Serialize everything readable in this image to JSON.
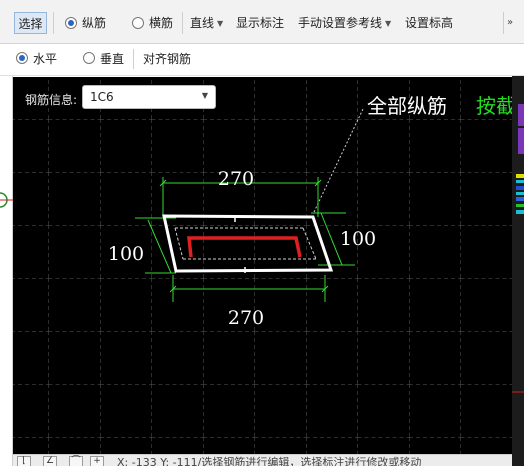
{
  "toolbar_top": {
    "select_label": "选择",
    "radio_longitudinal": "纵筋",
    "radio_transverse": "横筋",
    "line_menu": "直线",
    "show_annotation": "显示标注",
    "manual_reference_line": "手动设置参考线",
    "set_elevation": "设置标高"
  },
  "toolbar_second": {
    "radio_horizontal": "水平",
    "radio_vertical": "垂直",
    "align_rebar": "对齐钢筋"
  },
  "canvas": {
    "rebar_info_label": "钢筋信息:",
    "rebar_info_value": "1C6",
    "annotation_all_longitudinal": "全部纵筋",
    "annotation_green_partial": "按截",
    "dim_top": "270",
    "dim_bottom": "270",
    "dim_left": "100",
    "dim_right": "100"
  },
  "statusbar": {
    "text": "X: -133 Y: -111/选择钢筋进行编辑，选择标注进行修改或移动"
  },
  "colors": {
    "canvas_bg": "#000000",
    "rebar_red": "#e02020",
    "dimension_green": "#33dd33",
    "outline_white": "#ffffff",
    "accent_blue": "#2a64c5"
  }
}
